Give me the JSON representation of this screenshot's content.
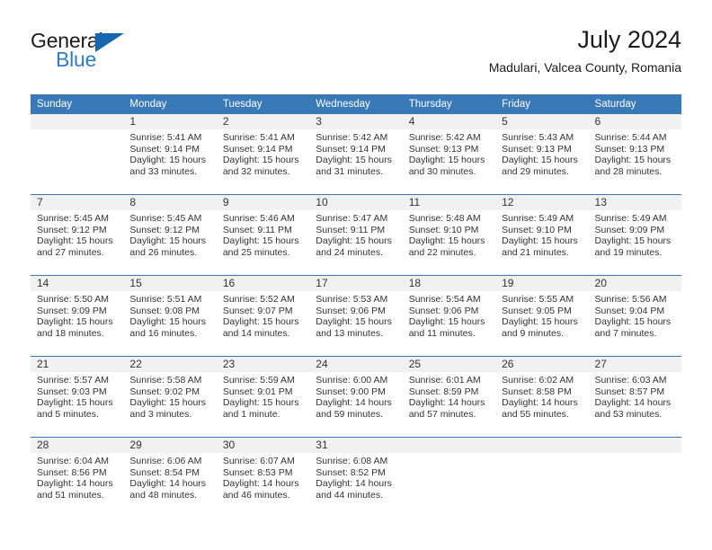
{
  "brand": {
    "name_top": "General",
    "name_bottom": "Blue",
    "triangle_icon": "triangle-icon",
    "color_dark": "#1b1b1b",
    "color_blue": "#2f7dc4"
  },
  "header": {
    "title": "July 2024",
    "subtitle": "Madulari, Valcea County, Romania"
  },
  "theme": {
    "header_blue": "#3a79b8",
    "daynum_band_gray": "#f1f1f1",
    "text": "#333333"
  },
  "calendar": {
    "weekday_headers": [
      "Sunday",
      "Monday",
      "Tuesday",
      "Wednesday",
      "Thursday",
      "Friday",
      "Saturday"
    ],
    "weeks": [
      [
        {
          "day": "",
          "sunrise": "",
          "sunset": "",
          "daylight_line1": "",
          "daylight_line2": ""
        },
        {
          "day": "1",
          "sunrise": "Sunrise: 5:41 AM",
          "sunset": "Sunset: 9:14 PM",
          "daylight_line1": "Daylight: 15 hours",
          "daylight_line2": "and 33 minutes."
        },
        {
          "day": "2",
          "sunrise": "Sunrise: 5:41 AM",
          "sunset": "Sunset: 9:14 PM",
          "daylight_line1": "Daylight: 15 hours",
          "daylight_line2": "and 32 minutes."
        },
        {
          "day": "3",
          "sunrise": "Sunrise: 5:42 AM",
          "sunset": "Sunset: 9:14 PM",
          "daylight_line1": "Daylight: 15 hours",
          "daylight_line2": "and 31 minutes."
        },
        {
          "day": "4",
          "sunrise": "Sunrise: 5:42 AM",
          "sunset": "Sunset: 9:13 PM",
          "daylight_line1": "Daylight: 15 hours",
          "daylight_line2": "and 30 minutes."
        },
        {
          "day": "5",
          "sunrise": "Sunrise: 5:43 AM",
          "sunset": "Sunset: 9:13 PM",
          "daylight_line1": "Daylight: 15 hours",
          "daylight_line2": "and 29 minutes."
        },
        {
          "day": "6",
          "sunrise": "Sunrise: 5:44 AM",
          "sunset": "Sunset: 9:13 PM",
          "daylight_line1": "Daylight: 15 hours",
          "daylight_line2": "and 28 minutes."
        }
      ],
      [
        {
          "day": "7",
          "sunrise": "Sunrise: 5:45 AM",
          "sunset": "Sunset: 9:12 PM",
          "daylight_line1": "Daylight: 15 hours",
          "daylight_line2": "and 27 minutes."
        },
        {
          "day": "8",
          "sunrise": "Sunrise: 5:45 AM",
          "sunset": "Sunset: 9:12 PM",
          "daylight_line1": "Daylight: 15 hours",
          "daylight_line2": "and 26 minutes."
        },
        {
          "day": "9",
          "sunrise": "Sunrise: 5:46 AM",
          "sunset": "Sunset: 9:11 PM",
          "daylight_line1": "Daylight: 15 hours",
          "daylight_line2": "and 25 minutes."
        },
        {
          "day": "10",
          "sunrise": "Sunrise: 5:47 AM",
          "sunset": "Sunset: 9:11 PM",
          "daylight_line1": "Daylight: 15 hours",
          "daylight_line2": "and 24 minutes."
        },
        {
          "day": "11",
          "sunrise": "Sunrise: 5:48 AM",
          "sunset": "Sunset: 9:10 PM",
          "daylight_line1": "Daylight: 15 hours",
          "daylight_line2": "and 22 minutes."
        },
        {
          "day": "12",
          "sunrise": "Sunrise: 5:49 AM",
          "sunset": "Sunset: 9:10 PM",
          "daylight_line1": "Daylight: 15 hours",
          "daylight_line2": "and 21 minutes."
        },
        {
          "day": "13",
          "sunrise": "Sunrise: 5:49 AM",
          "sunset": "Sunset: 9:09 PM",
          "daylight_line1": "Daylight: 15 hours",
          "daylight_line2": "and 19 minutes."
        }
      ],
      [
        {
          "day": "14",
          "sunrise": "Sunrise: 5:50 AM",
          "sunset": "Sunset: 9:09 PM",
          "daylight_line1": "Daylight: 15 hours",
          "daylight_line2": "and 18 minutes."
        },
        {
          "day": "15",
          "sunrise": "Sunrise: 5:51 AM",
          "sunset": "Sunset: 9:08 PM",
          "daylight_line1": "Daylight: 15 hours",
          "daylight_line2": "and 16 minutes."
        },
        {
          "day": "16",
          "sunrise": "Sunrise: 5:52 AM",
          "sunset": "Sunset: 9:07 PM",
          "daylight_line1": "Daylight: 15 hours",
          "daylight_line2": "and 14 minutes."
        },
        {
          "day": "17",
          "sunrise": "Sunrise: 5:53 AM",
          "sunset": "Sunset: 9:06 PM",
          "daylight_line1": "Daylight: 15 hours",
          "daylight_line2": "and 13 minutes."
        },
        {
          "day": "18",
          "sunrise": "Sunrise: 5:54 AM",
          "sunset": "Sunset: 9:06 PM",
          "daylight_line1": "Daylight: 15 hours",
          "daylight_line2": "and 11 minutes."
        },
        {
          "day": "19",
          "sunrise": "Sunrise: 5:55 AM",
          "sunset": "Sunset: 9:05 PM",
          "daylight_line1": "Daylight: 15 hours",
          "daylight_line2": "and 9 minutes."
        },
        {
          "day": "20",
          "sunrise": "Sunrise: 5:56 AM",
          "sunset": "Sunset: 9:04 PM",
          "daylight_line1": "Daylight: 15 hours",
          "daylight_line2": "and 7 minutes."
        }
      ],
      [
        {
          "day": "21",
          "sunrise": "Sunrise: 5:57 AM",
          "sunset": "Sunset: 9:03 PM",
          "daylight_line1": "Daylight: 15 hours",
          "daylight_line2": "and 5 minutes."
        },
        {
          "day": "22",
          "sunrise": "Sunrise: 5:58 AM",
          "sunset": "Sunset: 9:02 PM",
          "daylight_line1": "Daylight: 15 hours",
          "daylight_line2": "and 3 minutes."
        },
        {
          "day": "23",
          "sunrise": "Sunrise: 5:59 AM",
          "sunset": "Sunset: 9:01 PM",
          "daylight_line1": "Daylight: 15 hours",
          "daylight_line2": "and 1 minute."
        },
        {
          "day": "24",
          "sunrise": "Sunrise: 6:00 AM",
          "sunset": "Sunset: 9:00 PM",
          "daylight_line1": "Daylight: 14 hours",
          "daylight_line2": "and 59 minutes."
        },
        {
          "day": "25",
          "sunrise": "Sunrise: 6:01 AM",
          "sunset": "Sunset: 8:59 PM",
          "daylight_line1": "Daylight: 14 hours",
          "daylight_line2": "and 57 minutes."
        },
        {
          "day": "26",
          "sunrise": "Sunrise: 6:02 AM",
          "sunset": "Sunset: 8:58 PM",
          "daylight_line1": "Daylight: 14 hours",
          "daylight_line2": "and 55 minutes."
        },
        {
          "day": "27",
          "sunrise": "Sunrise: 6:03 AM",
          "sunset": "Sunset: 8:57 PM",
          "daylight_line1": "Daylight: 14 hours",
          "daylight_line2": "and 53 minutes."
        }
      ],
      [
        {
          "day": "28",
          "sunrise": "Sunrise: 6:04 AM",
          "sunset": "Sunset: 8:56 PM",
          "daylight_line1": "Daylight: 14 hours",
          "daylight_line2": "and 51 minutes."
        },
        {
          "day": "29",
          "sunrise": "Sunrise: 6:06 AM",
          "sunset": "Sunset: 8:54 PM",
          "daylight_line1": "Daylight: 14 hours",
          "daylight_line2": "and 48 minutes."
        },
        {
          "day": "30",
          "sunrise": "Sunrise: 6:07 AM",
          "sunset": "Sunset: 8:53 PM",
          "daylight_line1": "Daylight: 14 hours",
          "daylight_line2": "and 46 minutes."
        },
        {
          "day": "31",
          "sunrise": "Sunrise: 6:08 AM",
          "sunset": "Sunset: 8:52 PM",
          "daylight_line1": "Daylight: 14 hours",
          "daylight_line2": "and 44 minutes."
        },
        {
          "day": "",
          "sunrise": "",
          "sunset": "",
          "daylight_line1": "",
          "daylight_line2": ""
        },
        {
          "day": "",
          "sunrise": "",
          "sunset": "",
          "daylight_line1": "",
          "daylight_line2": ""
        },
        {
          "day": "",
          "sunrise": "",
          "sunset": "",
          "daylight_line1": "",
          "daylight_line2": ""
        }
      ]
    ]
  }
}
